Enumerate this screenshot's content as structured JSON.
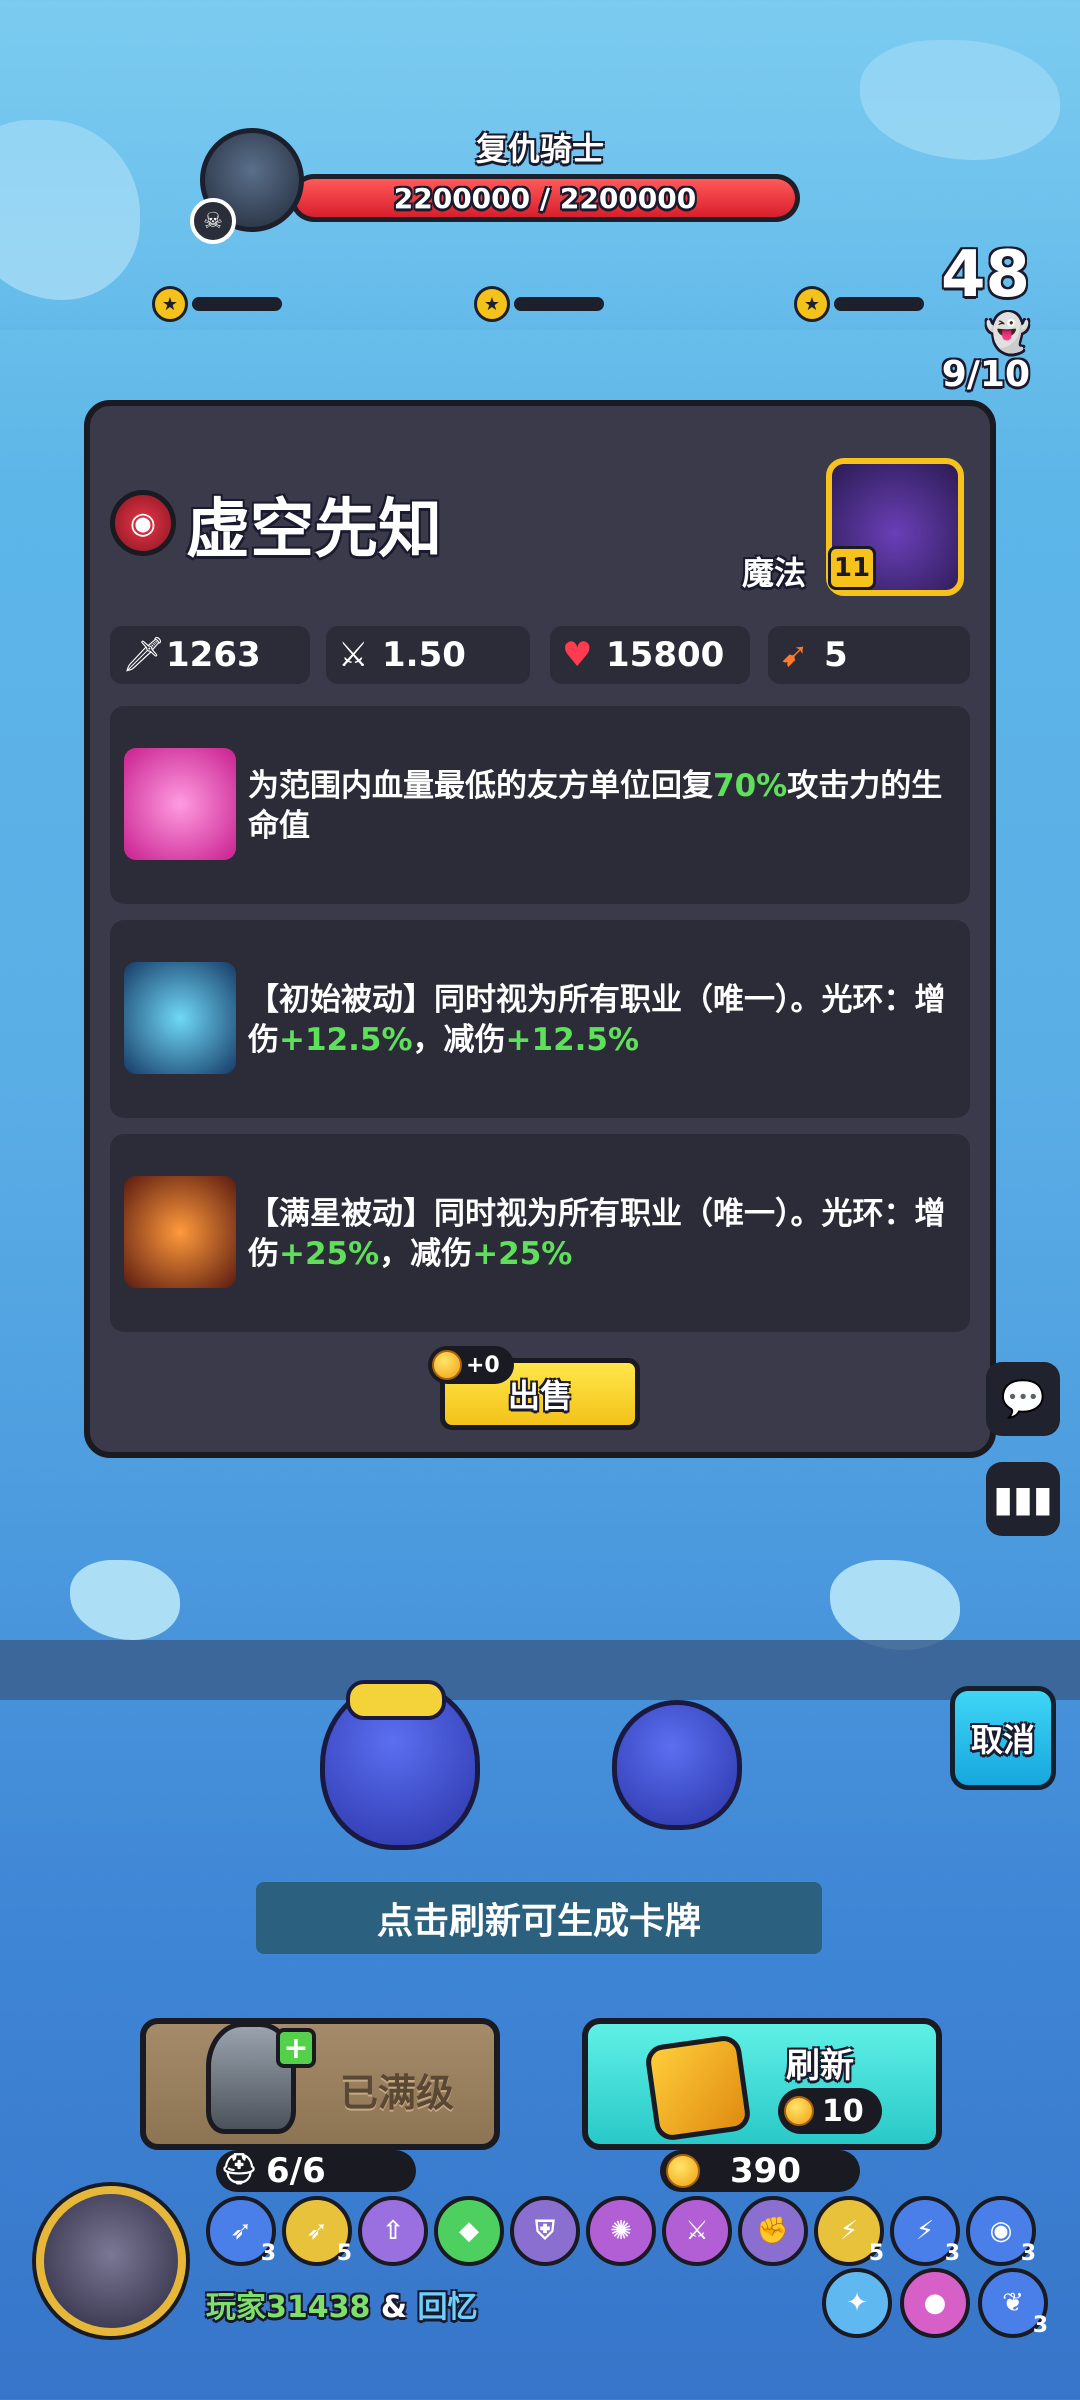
{
  "boss": {
    "name": "复仇骑士",
    "hp_text": "2200000 / 2200000",
    "hp_fraction": 1.0
  },
  "wave": "48",
  "ghosts": "9/10",
  "hero": {
    "name": "虚空先知",
    "type": "魔法",
    "level": "11",
    "stats": {
      "attack": "1263",
      "attack_speed": "1.50",
      "hp": "15800",
      "range": "5"
    },
    "skills": [
      {
        "icon": "heart-heal-icon",
        "parts": [
          "为范围内血量最低的友方单位回复",
          "70%",
          "攻击力的生命值"
        ]
      },
      {
        "icon": "shadow-aura-blue-icon",
        "parts": [
          "【初始被动】同时视为所有职业（唯一）。光环：增伤",
          "+12.5%",
          "，减伤",
          "+12.5%"
        ]
      },
      {
        "icon": "shadow-aura-red-icon",
        "parts": [
          "【满星被动】同时视为所有职业（唯一）。光环：增伤",
          "+25%",
          "，减伤",
          "+25%"
        ]
      }
    ],
    "sell_label": "出售",
    "sell_gain": "+0"
  },
  "cancel_label": "取消",
  "hint": "点击刷新可生成卡牌",
  "upgrade": {
    "label": "已满级",
    "count": "6/6"
  },
  "refresh": {
    "label": "刷新",
    "cost": "10"
  },
  "gold": "390",
  "player": {
    "name": "玩家31438",
    "amp": "&",
    "partner": "回忆"
  },
  "traits_row1": [
    {
      "icon": "bow-icon",
      "num": "3",
      "color": "#4a7ee8"
    },
    {
      "icon": "bow-gold-icon",
      "num": "5",
      "color": "#e8c23a"
    },
    {
      "icon": "arrow-up-icon",
      "num": "",
      "color": "#9a6fe0"
    },
    {
      "icon": "diamond-icon",
      "num": "",
      "color": "#4ed060"
    },
    {
      "icon": "shield-icon",
      "num": "",
      "color": "#8a6fd0"
    },
    {
      "icon": "swirl-icon",
      "num": "",
      "color": "#b25fd6"
    },
    {
      "icon": "sword-slash-icon",
      "num": "",
      "color": "#b25fd6"
    },
    {
      "icon": "fist-icon",
      "num": "",
      "color": "#8a6fd0"
    },
    {
      "icon": "runner-gold-icon",
      "num": "5",
      "color": "#e8c23a"
    },
    {
      "icon": "runner-blue-icon",
      "num": "3",
      "color": "#4a7ee8"
    },
    {
      "icon": "eye-icon",
      "num": "3",
      "color": "#4a7ee8"
    }
  ],
  "traits_row2": [
    {
      "icon": "bird-icon",
      "num": "",
      "color": "#5fb8f0"
    },
    {
      "icon": "pig-icon",
      "num": "",
      "color": "#d65fc8"
    },
    {
      "icon": "wings-icon",
      "num": "3",
      "color": "#4a7ee8"
    }
  ],
  "colors": {
    "panel": "#3b3a4a",
    "accent_green": "#5ee05a",
    "gold": "#f3c21a"
  }
}
